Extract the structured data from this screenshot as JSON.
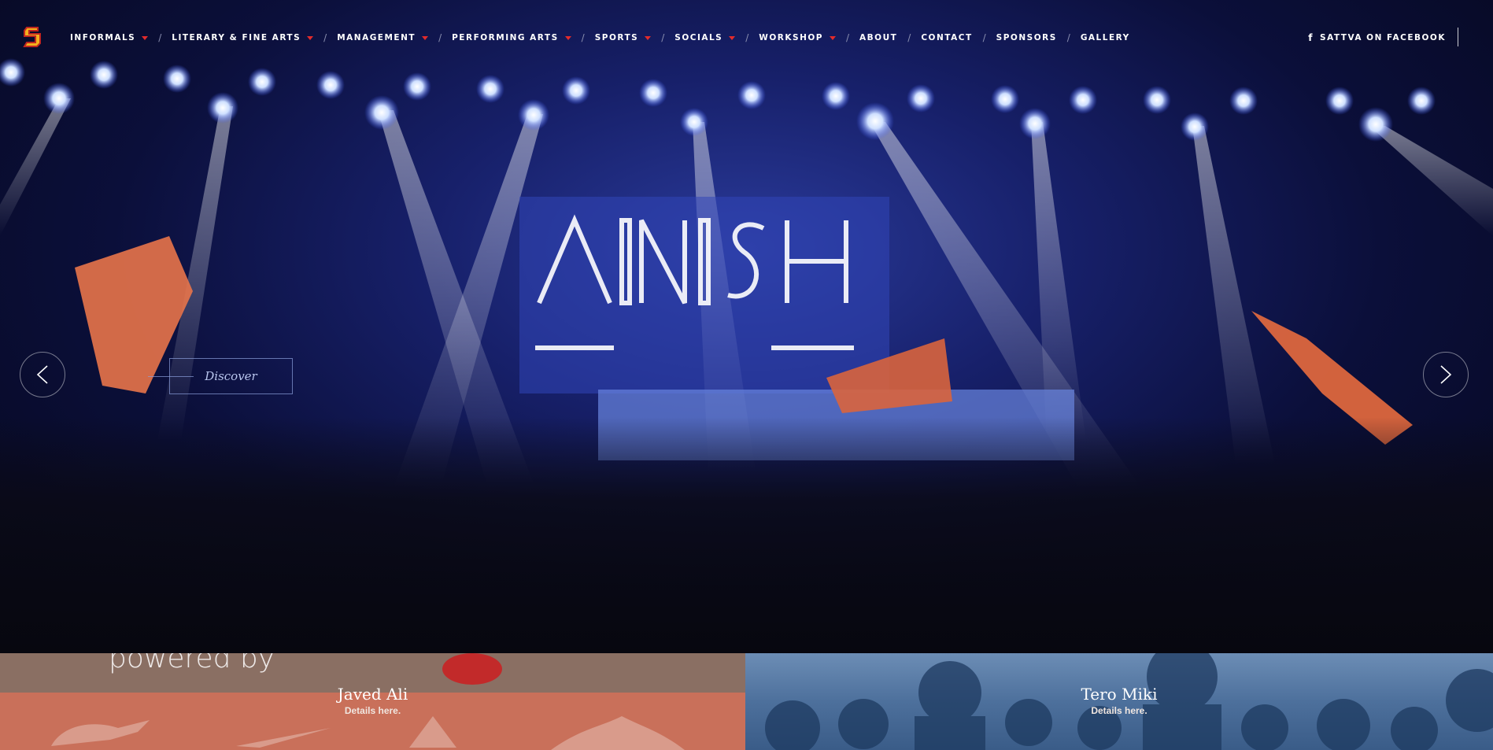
{
  "nav": {
    "items": [
      {
        "label": "INFORMALS",
        "dropdown": true
      },
      {
        "label": "LITERARY & FINE ARTS",
        "dropdown": true
      },
      {
        "label": "MANAGEMENT",
        "dropdown": true
      },
      {
        "label": "PERFORMING ARTS",
        "dropdown": true
      },
      {
        "label": "SPORTS",
        "dropdown": true
      },
      {
        "label": "SOCIALS",
        "dropdown": true
      },
      {
        "label": "WORKSHOP",
        "dropdown": true
      },
      {
        "label": "ABOUT",
        "dropdown": false
      },
      {
        "label": "CONTACT",
        "dropdown": false
      },
      {
        "label": "SPONSORS",
        "dropdown": false
      },
      {
        "label": "GALLERY",
        "dropdown": false
      }
    ],
    "separator": "/",
    "facebook_label": "SATTVA ON FACEBOOK",
    "facebook_icon": "f",
    "accent_color": "#e32b2b"
  },
  "hero": {
    "discover_label": "Discover",
    "prev_icon": "chevron-left-icon",
    "next_icon": "chevron-right-icon"
  },
  "panels": [
    {
      "title": "Javed Ali",
      "subtitle": "Details here.",
      "overlay_text": "powered by"
    },
    {
      "title": "Tero Miki",
      "subtitle": "Details here."
    }
  ]
}
